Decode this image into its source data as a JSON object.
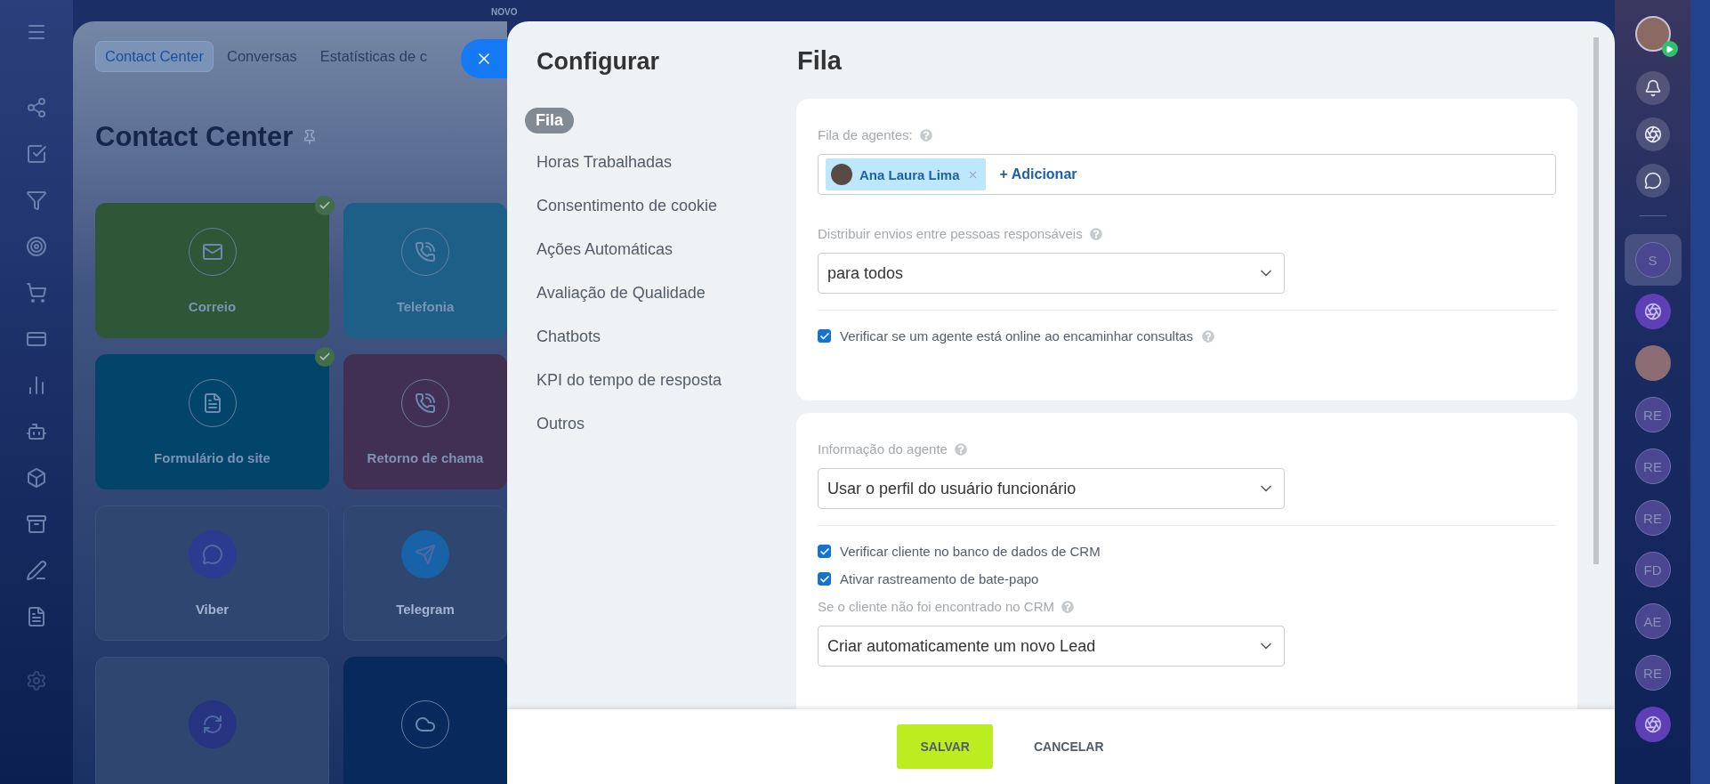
{
  "background": {
    "badge": "NOVO",
    "tabs": [
      {
        "label": "Contact Center",
        "selected": true
      },
      {
        "label": "Conversas",
        "selected": false
      },
      {
        "label": "Estatísticas de c",
        "selected": false
      }
    ],
    "title": "Contact Center",
    "tiles": [
      {
        "label": "Correio",
        "kind": "filled",
        "color": "#2f5636",
        "connected": true
      },
      {
        "label": "Telefonia",
        "kind": "filled",
        "color": "#1d5f87",
        "connected": false
      },
      {
        "label": "Formulário do site",
        "kind": "filled",
        "color": "#02446a",
        "connected": true
      },
      {
        "label": "Retorno de chama",
        "kind": "filled",
        "color": "#412f54",
        "connected": false
      },
      {
        "label": "Viber",
        "kind": "outline",
        "color": "#2c3b8f",
        "connected": false
      },
      {
        "label": "Telegram",
        "kind": "outline",
        "color": "#1862a8",
        "connected": false
      },
      {
        "kind": "outline",
        "color": "#263482",
        "connected": false
      },
      {
        "kind": "filled",
        "color": "#08295c",
        "connected": false
      }
    ]
  },
  "panel": {
    "nav": {
      "title": "Configurar",
      "items": [
        {
          "label": "Fila",
          "selected": true
        },
        {
          "label": "Horas Trabalhadas",
          "selected": false
        },
        {
          "label": "Consentimento de cookie",
          "selected": false
        },
        {
          "label": "Ações Automáticas",
          "selected": false
        },
        {
          "label": "Avaliação de Qualidade",
          "selected": false
        },
        {
          "label": "Chatbots",
          "selected": false
        },
        {
          "label": "KPI do tempo de resposta",
          "selected": false
        },
        {
          "label": "Outros",
          "selected": false
        }
      ]
    },
    "title": "Fila",
    "sections": [
      {
        "fields": [
          {
            "kind": "people",
            "label": "Fila de agentes:",
            "help": true,
            "people": [
              "Ana Laura Lima"
            ],
            "add": "+ Adicionar"
          },
          {
            "kind": "select",
            "label": "Distribuir envios entre pessoas responsáveis",
            "help": true,
            "value": "para todos"
          },
          {
            "kind": "divider"
          },
          {
            "kind": "checkbox",
            "label": "Verificar se um agente está online ao encaminhar consultas",
            "checked": true,
            "help": true
          }
        ]
      },
      {
        "fields": [
          {
            "kind": "select",
            "label": "Informação do agente",
            "help": true,
            "value": "Usar o perfil do usuário funcionário"
          },
          {
            "kind": "divider"
          },
          {
            "kind": "checkbox",
            "label": "Verificar cliente no banco de dados de CRM",
            "checked": true,
            "help": false
          },
          {
            "kind": "checkbox",
            "label": "Ativar rastreamento de bate-papo",
            "checked": true,
            "help": false
          },
          {
            "kind": "select",
            "label": "Se o cliente não foi encontrado no CRM",
            "help": true,
            "value": "Criar automaticamente um novo Lead"
          }
        ]
      }
    ],
    "buttons": [
      {
        "label": "SALVAR",
        "kind": "primary"
      },
      {
        "label": "CANCELAR",
        "kind": "link"
      }
    ]
  },
  "right_bar": {
    "chats": [
      {
        "kind": "initials",
        "text": "S",
        "selected": true
      },
      {
        "kind": "icon",
        "selected": false
      },
      {
        "kind": "photo",
        "selected": false
      },
      {
        "kind": "initials",
        "text": "RE",
        "selected": false
      },
      {
        "kind": "initials",
        "text": "RE",
        "selected": false
      },
      {
        "kind": "initials",
        "text": "RE",
        "selected": false
      },
      {
        "kind": "initials",
        "text": "FD",
        "selected": false
      },
      {
        "kind": "initials",
        "text": "AE",
        "selected": false
      },
      {
        "kind": "initials",
        "text": "RE",
        "selected": false
      },
      {
        "kind": "icon",
        "selected": false
      }
    ]
  }
}
